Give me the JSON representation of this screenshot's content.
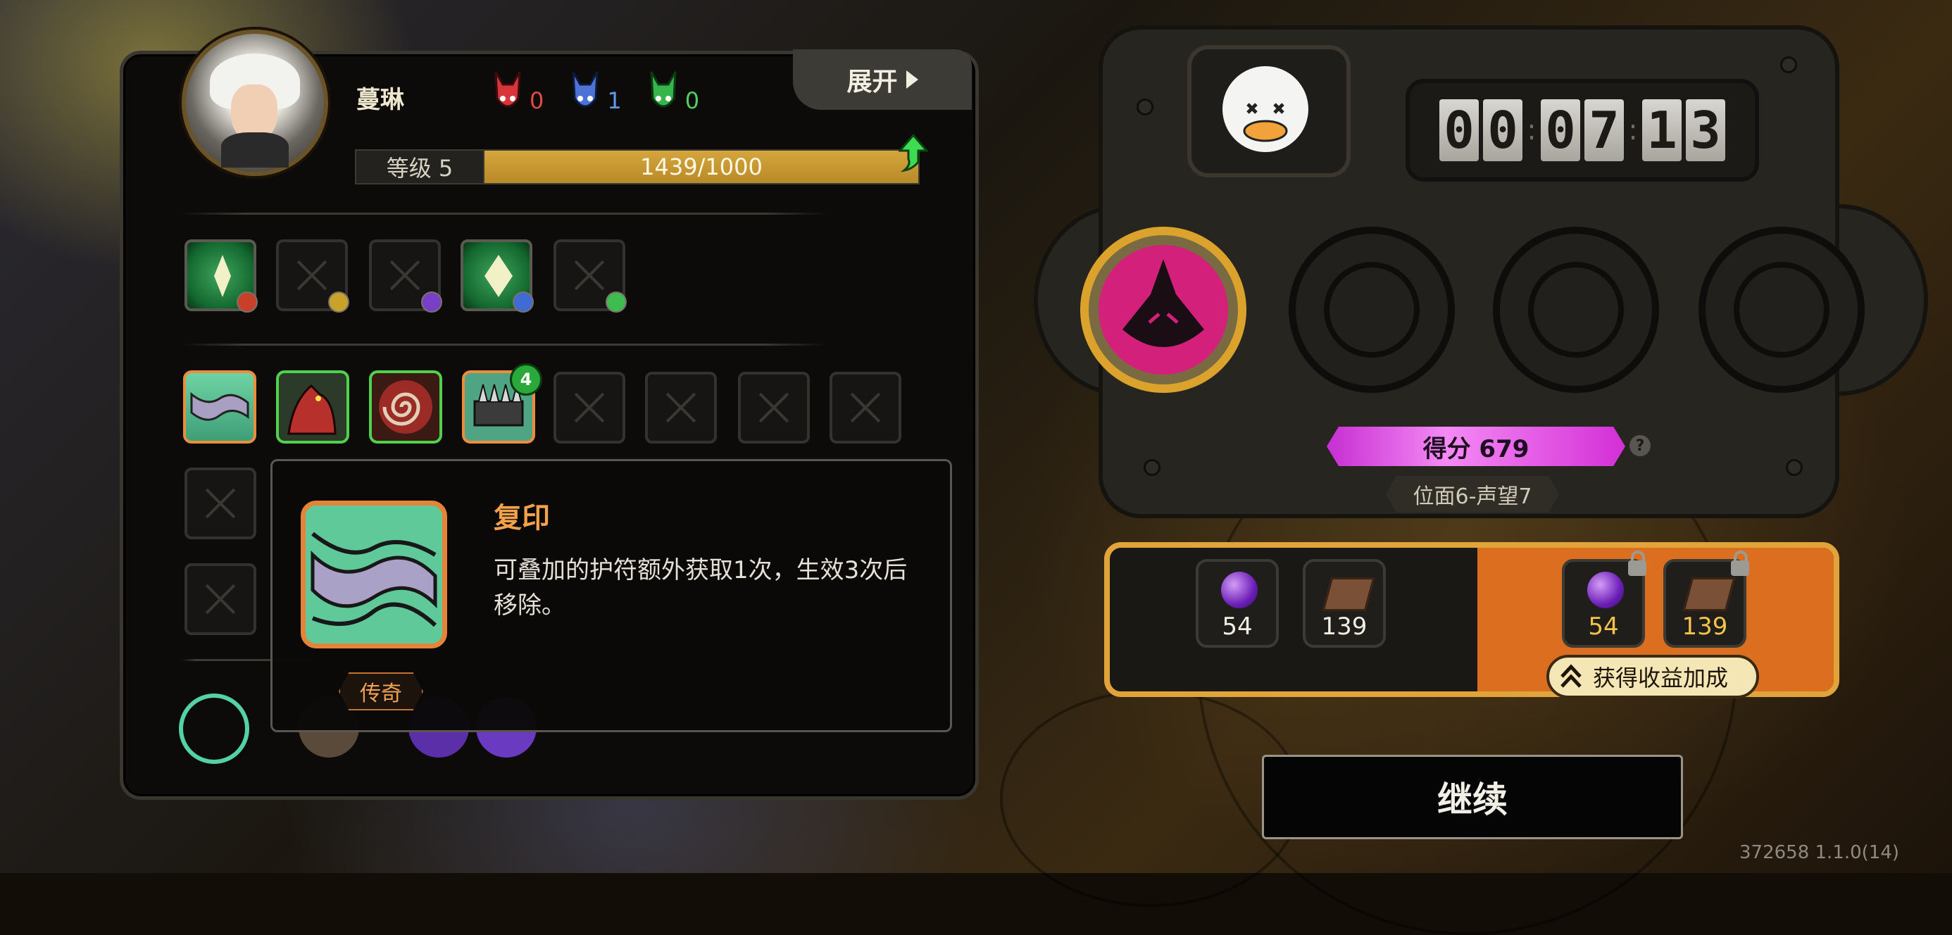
{
  "character": {
    "name": "蔓琳",
    "level_label": "等级 5",
    "xp_text": "1439/1000",
    "xp_fraction": 1.0
  },
  "horns": [
    {
      "icon": "red-horn-icon",
      "color": "#d9343a",
      "count": "0"
    },
    {
      "icon": "blue-horn-icon",
      "color": "#4d73d6",
      "count": "1"
    },
    {
      "icon": "green-horn-icon",
      "color": "#35b54a",
      "count": "0"
    }
  ],
  "expand_button": "展开",
  "tooltip": {
    "title": "复印",
    "description": "可叠加的护符额外获取1次，生效3次后移除。",
    "rarity": "传奇"
  },
  "relic_badge": "4",
  "timer": {
    "digits": [
      "0",
      "0",
      "0",
      "7",
      "1",
      "3"
    ]
  },
  "score_label": "得分 679",
  "help_symbol": "?",
  "plane_label": "位面6-声望7",
  "rewards": {
    "base": [
      {
        "icon": "purple-orb-icon",
        "value": "54"
      },
      {
        "icon": "book-icon",
        "value": "139"
      }
    ],
    "bonus": [
      {
        "icon": "purple-orb-icon",
        "value": "54"
      },
      {
        "icon": "book-icon",
        "value": "139"
      }
    ],
    "bonus_button": "获得收益加成"
  },
  "continue_button": "继续",
  "version": "372658 1.1.0(14)",
  "colors": {
    "accent_gold": "#e1a43a",
    "score_magenta": "#e25be6",
    "bonus_orange": "#dc6e1f"
  }
}
